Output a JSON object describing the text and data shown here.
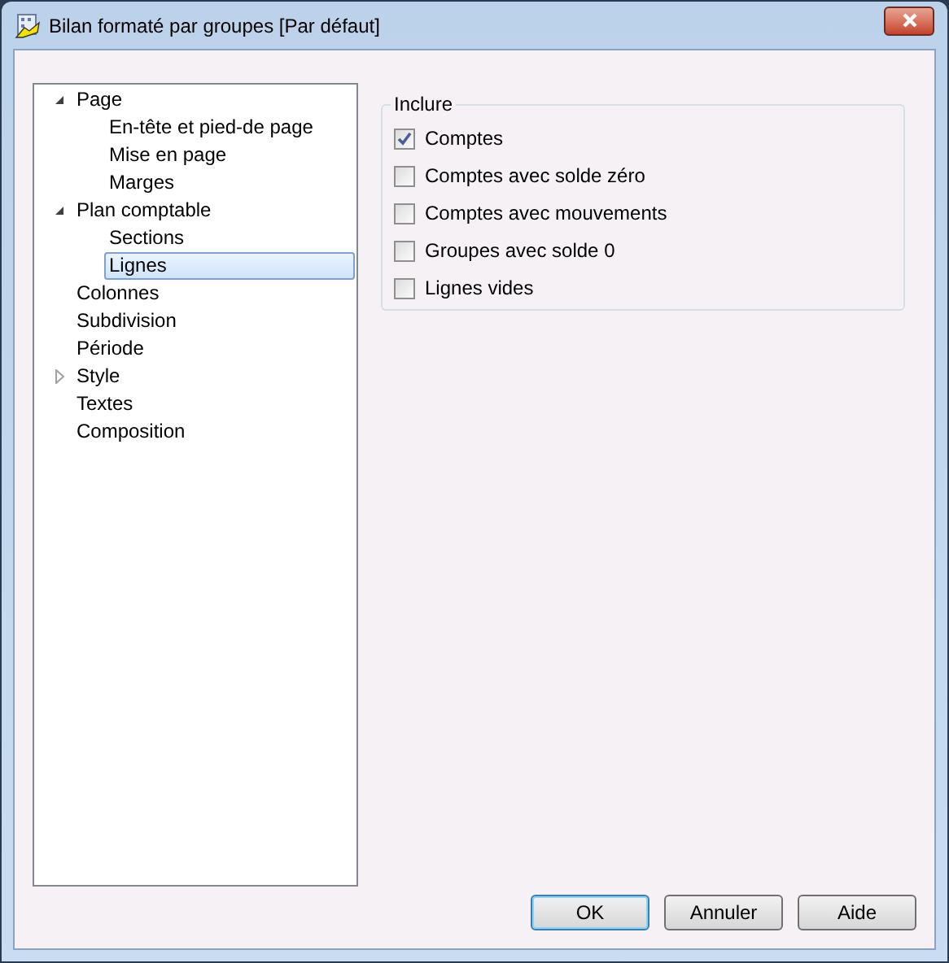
{
  "window": {
    "title": "Bilan formaté par groupes [Par défaut]"
  },
  "tree": [
    {
      "label": "Page",
      "expanded": true,
      "selected": false,
      "children": [
        {
          "label": "En-tête et pied-de page",
          "selected": false
        },
        {
          "label": "Mise en page",
          "selected": false
        },
        {
          "label": "Marges",
          "selected": false
        }
      ]
    },
    {
      "label": "Plan comptable",
      "expanded": true,
      "selected": false,
      "children": [
        {
          "label": "Sections",
          "selected": false
        },
        {
          "label": "Lignes",
          "selected": true
        }
      ]
    },
    {
      "label": "Colonnes",
      "selected": false
    },
    {
      "label": "Subdivision",
      "selected": false
    },
    {
      "label": "Période",
      "selected": false
    },
    {
      "label": "Style",
      "expanded": false,
      "selected": false
    },
    {
      "label": "Textes",
      "selected": false
    },
    {
      "label": "Composition",
      "selected": false
    }
  ],
  "group": {
    "title": "Inclure",
    "options": [
      {
        "label": "Comptes",
        "checked": true
      },
      {
        "label": "Comptes avec solde zéro",
        "checked": false
      },
      {
        "label": "Comptes avec mouvements",
        "checked": false
      },
      {
        "label": "Groupes avec solde 0",
        "checked": false
      },
      {
        "label": "Lignes vides",
        "checked": false
      }
    ]
  },
  "buttons": [
    {
      "label": "OK",
      "default": true
    },
    {
      "label": "Annuler",
      "default": false
    },
    {
      "label": "Aide",
      "default": false
    }
  ]
}
